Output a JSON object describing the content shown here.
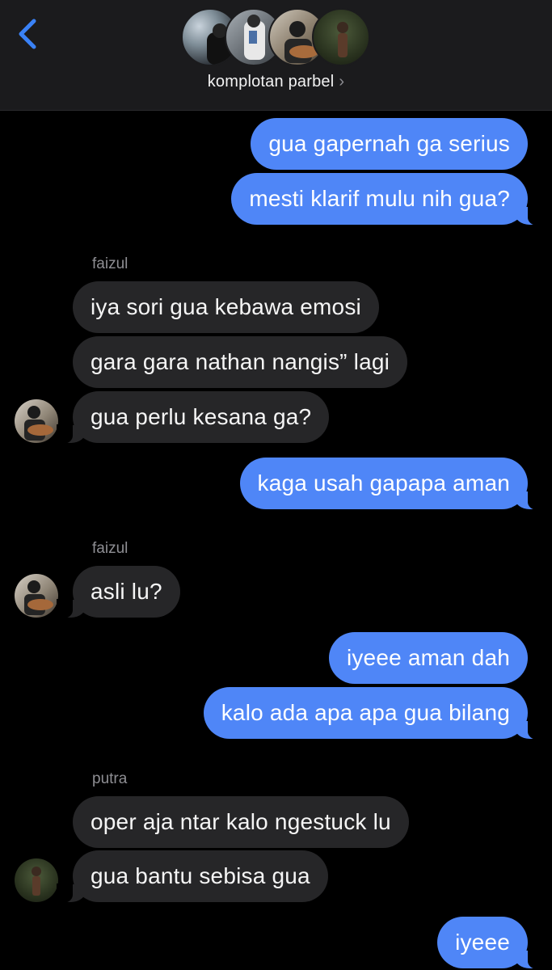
{
  "header": {
    "group_name": "komplotan parbel",
    "chevron": "›",
    "back_icon": "chevron-left-icon",
    "accent": "#3a82f7"
  },
  "colors": {
    "outgoing": "#4f86f7",
    "incoming": "#262628",
    "background": "#000000"
  },
  "messages": [
    {
      "dir": "out",
      "text": "gua gapernah ga serius"
    },
    {
      "dir": "out",
      "text": "mesti klarif mulu nih gua?"
    },
    {
      "sender": "faizul"
    },
    {
      "dir": "in",
      "text": "iya sori gua kebawa emosi"
    },
    {
      "dir": "in",
      "text": "gara gara nathan nangis” lagi"
    },
    {
      "dir": "in",
      "text": "gua perlu kesana ga?"
    },
    {
      "dir": "out",
      "text": "kaga usah gapapa aman"
    },
    {
      "sender": "faizul"
    },
    {
      "dir": "in",
      "text": "asli lu?"
    },
    {
      "dir": "out",
      "text": "iyeee aman dah"
    },
    {
      "dir": "out",
      "text": "kalo ada apa apa gua bilang"
    },
    {
      "sender": "putra"
    },
    {
      "dir": "in",
      "text": "oper aja ntar kalo ngestuck lu"
    },
    {
      "dir": "in",
      "text": "gua bantu sebisa gua"
    },
    {
      "dir": "out",
      "text": "iyeee"
    }
  ]
}
